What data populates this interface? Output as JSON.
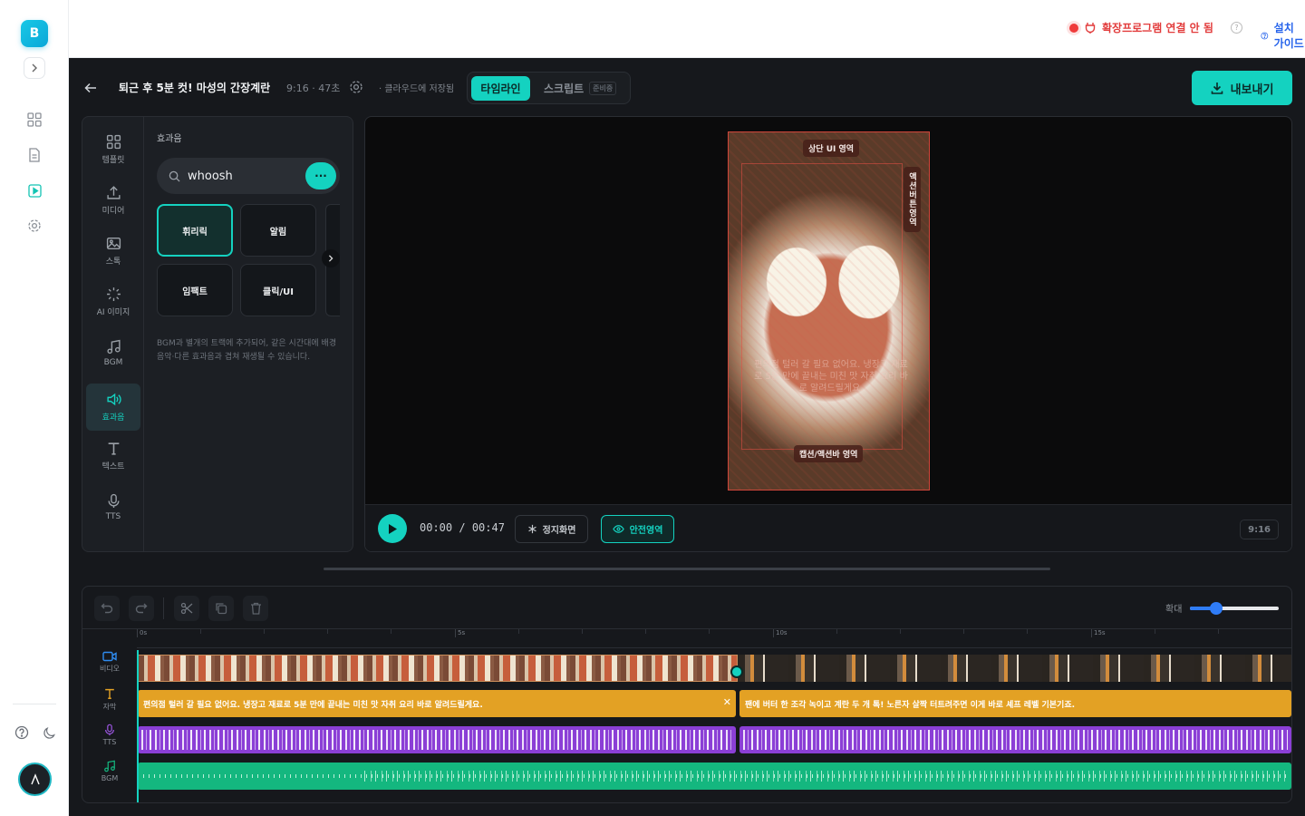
{
  "rail": {
    "brand_letter": "B",
    "expand_icon": "chevron-right-icon",
    "nav_icons": [
      "dashboard-icon",
      "document-icon",
      "video-editor-icon",
      "settings-icon"
    ],
    "bottom_icons": [
      "help-icon",
      "dark-mode-icon"
    ],
    "avatar_icon": "user-avatar-icon"
  },
  "topbar": {
    "extension_status": "확장프로그램 연결 안 됨",
    "install_guide": "설치 가이드"
  },
  "header": {
    "title": "퇴근 후 5분 컷! 마성의 간장계란밥",
    "meta": "9:16 · 47초",
    "saved": "· 클라우드에 저장됨",
    "tabs": [
      {
        "label": "타임라인",
        "active": true
      },
      {
        "label": "스크립트",
        "badge": "준비중",
        "active": false
      }
    ],
    "export_label": "내보내기"
  },
  "panel": {
    "categories": [
      {
        "label": "템플릿",
        "icon": "template-icon"
      },
      {
        "label": "미디어",
        "icon": "upload-icon"
      },
      {
        "label": "스톡",
        "icon": "image-icon"
      },
      {
        "label": "AI 이미지",
        "icon": "sparkle-icon"
      },
      {
        "label": "BGM",
        "icon": "music-icon"
      },
      {
        "label": "효과음",
        "icon": "sound-effect-icon",
        "active": true
      },
      {
        "label": "텍스트",
        "icon": "text-icon"
      },
      {
        "label": "TTS",
        "icon": "mic-icon"
      }
    ],
    "title": "효과음",
    "search_value": "whoosh",
    "search_button": "···",
    "chips": [
      "휘리릭",
      "알림",
      "임팩트",
      "클릭/UI"
    ],
    "hint": "BGM과 별개의 트랙에 추가되어, 같은 시간대에 배경음악·다른 효과음과 겹쳐 재생될 수 있습니다."
  },
  "preview": {
    "overlays": {
      "top": "상단 UI 영역",
      "side": "액션버튼영역",
      "bottom": "캡션/액션바 영역"
    },
    "caption_ghost": "편의점 털러 갈 필요 없어요. 냉장고 재료로 5분 만에 끝내는 미친 맛 자취 요리 바로 알려드릴게요.",
    "time_current": "00:00",
    "time_sep": "/",
    "time_total": "00:47",
    "still_label": "정지화면",
    "safe_label": "안전영역",
    "ratio": "9:16"
  },
  "timeline": {
    "zoom_label": "확대",
    "zoom_level": 0.3,
    "ruler": [
      "0s",
      "5s",
      "10s",
      "15s"
    ],
    "tracks": [
      {
        "label": "비디오",
        "icon": "video-icon"
      },
      {
        "label": "자막",
        "icon": "text-icon"
      },
      {
        "label": "TTS",
        "icon": "mic-icon"
      },
      {
        "label": "BGM",
        "icon": "music-icon"
      }
    ],
    "captions": [
      "편의점 털러 갈 필요 없어요. 냉장고 재료로 5분 만에 끝내는 미친 맛 자취 요리 바로 알려드릴게요.",
      "팬에 버터 한 조각 녹이고 계란 두 개 톡! 노른자 살짝 터트려주면 이게 바로 셰프 레벨 기본기죠."
    ]
  },
  "colors": {
    "accent": "#14d2c0",
    "danger": "#e23b3b",
    "link": "#2563eb",
    "caption_track": "#e3a124",
    "tts_track": "#8b3fd6",
    "bgm_track": "#14b77f"
  }
}
